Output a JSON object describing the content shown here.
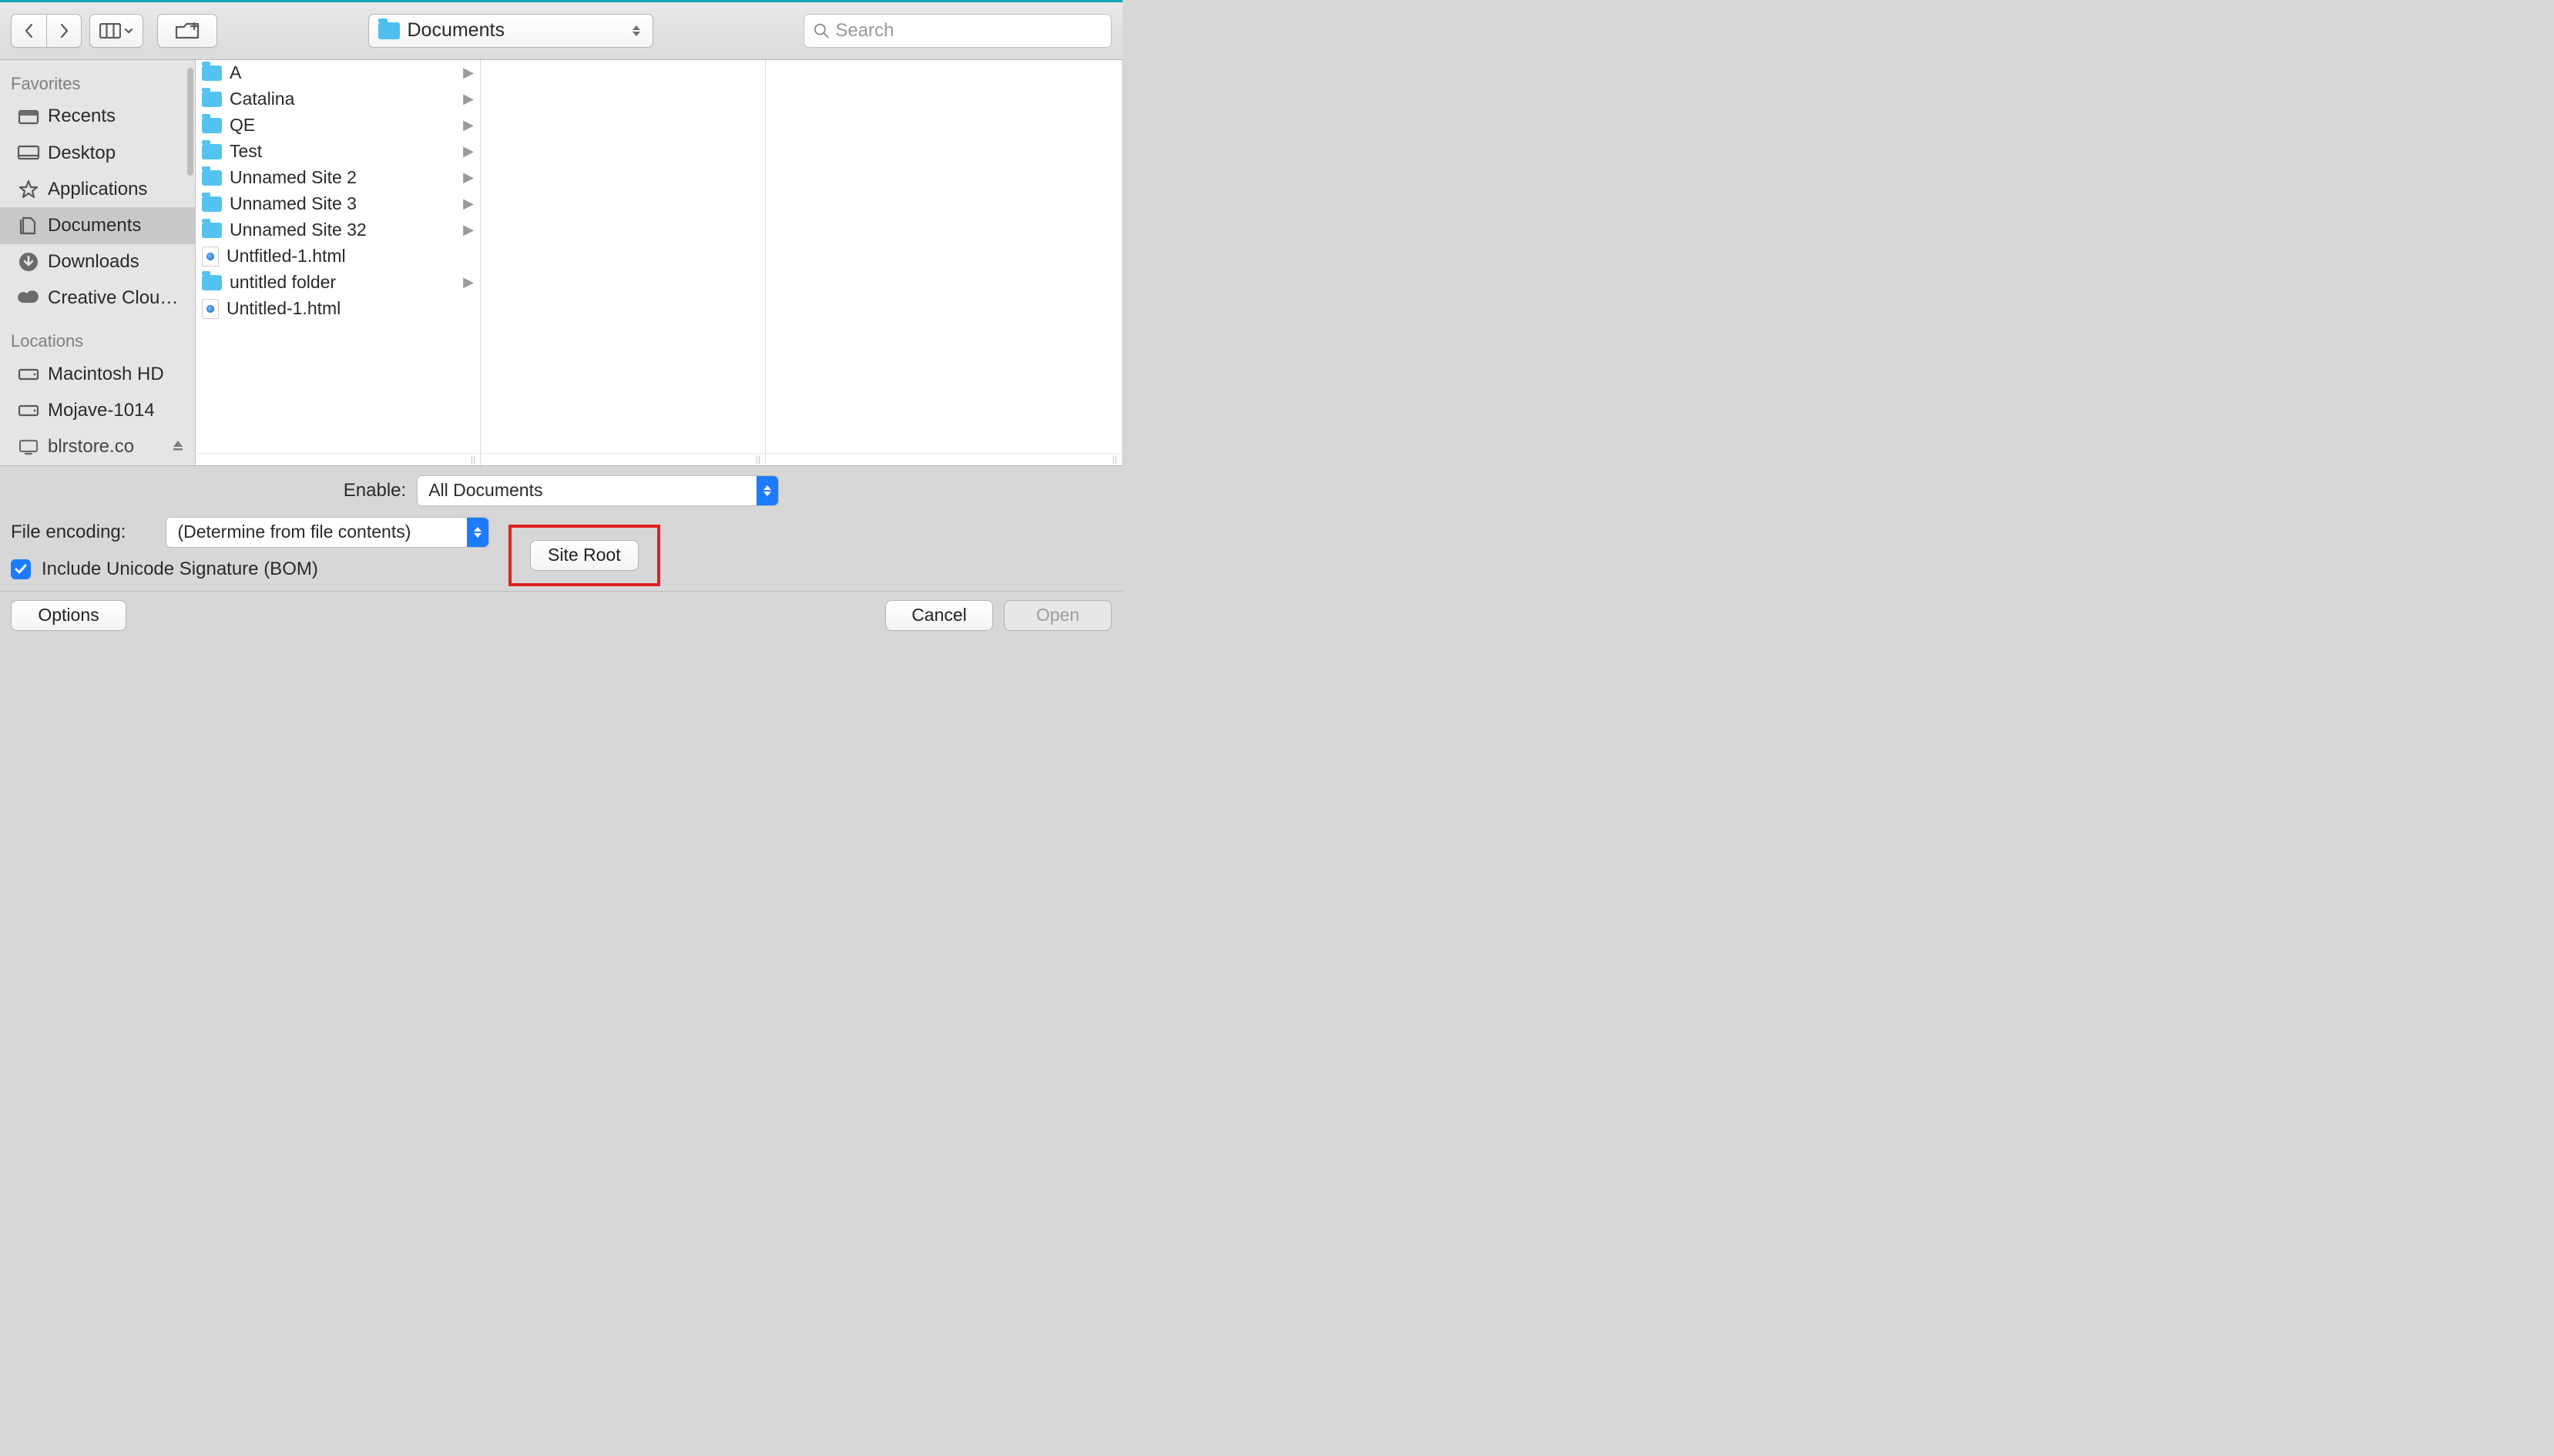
{
  "toolbar": {
    "path_label": "Documents",
    "search_placeholder": "Search"
  },
  "sidebar": {
    "groups": [
      {
        "heading": "Favorites",
        "items": [
          {
            "label": "Recents",
            "icon": "recents-icon",
            "selected": false
          },
          {
            "label": "Desktop",
            "icon": "desktop-icon",
            "selected": false
          },
          {
            "label": "Applications",
            "icon": "applications-icon",
            "selected": false
          },
          {
            "label": "Documents",
            "icon": "documents-icon",
            "selected": true
          },
          {
            "label": "Downloads",
            "icon": "downloads-icon",
            "selected": false
          },
          {
            "label": "Creative Clou…",
            "icon": "creative-cloud-icon",
            "selected": false
          }
        ]
      },
      {
        "heading": "Locations",
        "items": [
          {
            "label": "Macintosh HD",
            "icon": "disk-icon",
            "selected": false
          },
          {
            "label": "Mojave-1014",
            "icon": "disk-icon",
            "selected": false
          },
          {
            "label": "blrstore.co",
            "icon": "network-icon",
            "selected": false,
            "eject": true,
            "truncated": true
          }
        ]
      }
    ]
  },
  "column_items": [
    {
      "name": "A",
      "type": "folder"
    },
    {
      "name": "Catalina",
      "type": "folder"
    },
    {
      "name": "QE",
      "type": "folder"
    },
    {
      "name": "Test",
      "type": "folder"
    },
    {
      "name": "Unnamed Site 2",
      "type": "folder"
    },
    {
      "name": "Unnamed Site 3",
      "type": "folder"
    },
    {
      "name": "Unnamed Site 32",
      "type": "folder"
    },
    {
      "name": "Untfitled-1.html",
      "type": "html"
    },
    {
      "name": "untitled folder",
      "type": "folder"
    },
    {
      "name": "Untitled-1.html",
      "type": "html"
    }
  ],
  "options": {
    "enable_label": "Enable:",
    "enable_value": "All Documents",
    "encoding_label": "File encoding:",
    "encoding_value": "(Determine from file contents)",
    "bom_label": "Include Unicode Signature (BOM)",
    "bom_checked": true,
    "site_root_label": "Site Root"
  },
  "footer": {
    "options_label": "Options",
    "cancel_label": "Cancel",
    "open_label": "Open"
  }
}
